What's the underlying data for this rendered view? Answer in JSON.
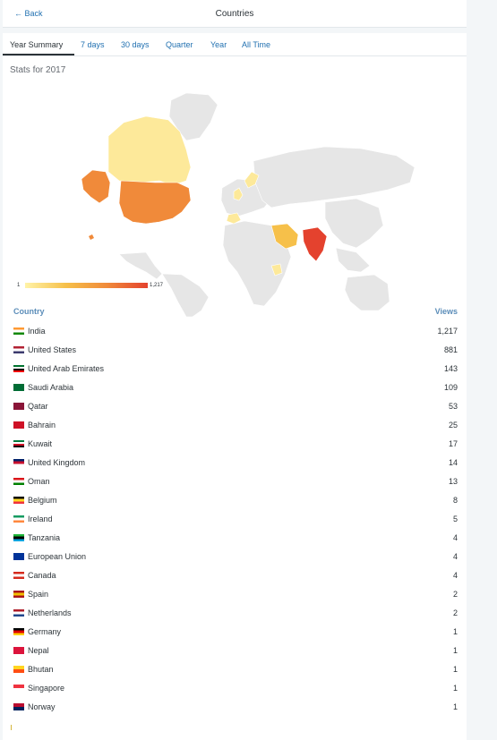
{
  "header": {
    "back_label": "Back",
    "title": "Countries"
  },
  "tabs": [
    {
      "label": "Year Summary",
      "active": true
    },
    {
      "label": "7 days"
    },
    {
      "label": "30 days"
    },
    {
      "label": "Quarter"
    },
    {
      "label": "Year"
    },
    {
      "label": "All Time"
    }
  ],
  "stats_label": "Stats for 2017",
  "legend": {
    "min": "1",
    "max": "1,217",
    "colors": [
      "#fff3a8",
      "#f6c04a",
      "#f08a3a",
      "#e4422e"
    ]
  },
  "table": {
    "col_country": "Country",
    "col_views": "Views",
    "rows": [
      {
        "country": "India",
        "views": "1,217",
        "flag": [
          "#ff9933",
          "#ffffff",
          "#138808"
        ]
      },
      {
        "country": "United States",
        "views": "881",
        "flag": [
          "#b22234",
          "#ffffff",
          "#3c3b6e"
        ]
      },
      {
        "country": "United Arab Emirates",
        "views": "143",
        "flag": [
          "#00732f",
          "#ffffff",
          "#000000",
          "#ff0000"
        ]
      },
      {
        "country": "Saudi Arabia",
        "views": "109",
        "flag": [
          "#006c35"
        ]
      },
      {
        "country": "Qatar",
        "views": "53",
        "flag": [
          "#8a1538"
        ]
      },
      {
        "country": "Bahrain",
        "views": "25",
        "flag": [
          "#ce1126"
        ]
      },
      {
        "country": "Kuwait",
        "views": "17",
        "flag": [
          "#007a3d",
          "#ffffff",
          "#ce1126",
          "#000000"
        ]
      },
      {
        "country": "United Kingdom",
        "views": "14",
        "flag": [
          "#012169",
          "#c8102e",
          "#ffffff"
        ]
      },
      {
        "country": "Oman",
        "views": "13",
        "flag": [
          "#db161b",
          "#ffffff",
          "#008000"
        ]
      },
      {
        "country": "Belgium",
        "views": "8",
        "flag": [
          "#000000",
          "#fdda24",
          "#ef3340"
        ]
      },
      {
        "country": "Ireland",
        "views": "5",
        "flag": [
          "#169b62",
          "#ffffff",
          "#ff883e"
        ]
      },
      {
        "country": "Tanzania",
        "views": "4",
        "flag": [
          "#1eb53a",
          "#000000",
          "#00a3dd"
        ]
      },
      {
        "country": "European Union",
        "views": "4",
        "flag": [
          "#003399"
        ]
      },
      {
        "country": "Canada",
        "views": "4",
        "flag": [
          "#d52b1e",
          "#ffffff",
          "#d52b1e"
        ]
      },
      {
        "country": "Spain",
        "views": "2",
        "flag": [
          "#aa151b",
          "#f1bf00",
          "#aa151b"
        ]
      },
      {
        "country": "Netherlands",
        "views": "2",
        "flag": [
          "#ae1c28",
          "#ffffff",
          "#21468b"
        ]
      },
      {
        "country": "Germany",
        "views": "1",
        "flag": [
          "#000000",
          "#dd0000",
          "#ffce00"
        ]
      },
      {
        "country": "Nepal",
        "views": "1",
        "flag": [
          "#dc143c"
        ]
      },
      {
        "country": "Bhutan",
        "views": "1",
        "flag": [
          "#ffd520",
          "#ff4e12"
        ]
      },
      {
        "country": "Singapore",
        "views": "1",
        "flag": [
          "#ef3340",
          "#ffffff"
        ]
      },
      {
        "country": "Norway",
        "views": "1",
        "flag": [
          "#ba0c2f",
          "#00205b"
        ]
      }
    ]
  }
}
